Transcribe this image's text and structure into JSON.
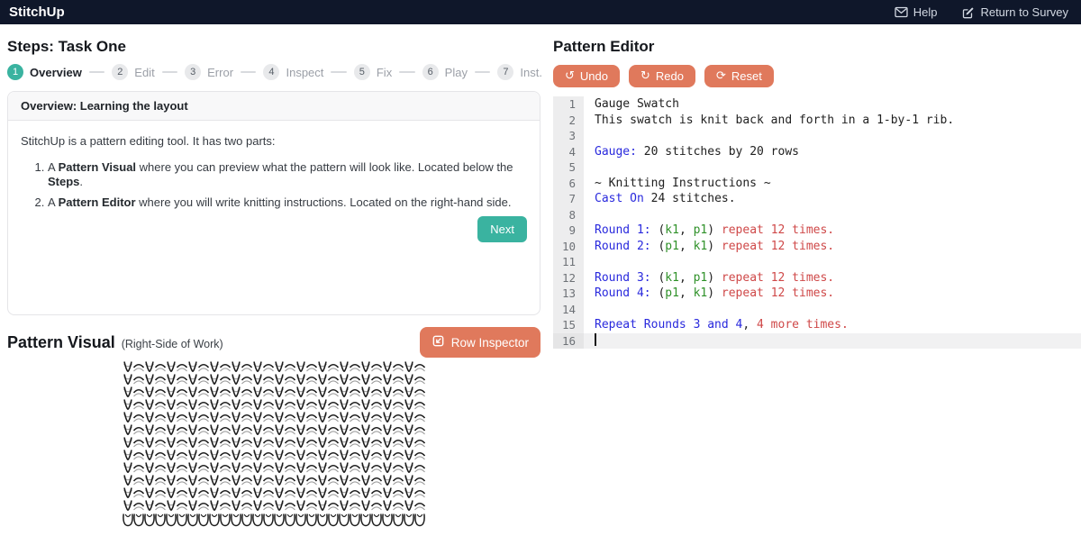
{
  "theme": {
    "navbar_bg": "#0f172a",
    "accent_teal": "#3ab3a0",
    "accent_salmon": "#e0795c",
    "code_blue": "#2929dd",
    "code_green": "#2f9129",
    "code_red": "#cf4848"
  },
  "navbar": {
    "brand": "StitchUp",
    "help_label": "Help",
    "return_label": "Return to Survey"
  },
  "steps": {
    "title": "Steps: Task One",
    "items": [
      {
        "num": "1",
        "label": "Overview",
        "active": true
      },
      {
        "num": "2",
        "label": "Edit",
        "active": false
      },
      {
        "num": "3",
        "label": "Error",
        "active": false
      },
      {
        "num": "4",
        "label": "Inspect",
        "active": false
      },
      {
        "num": "5",
        "label": "Fix",
        "active": false
      },
      {
        "num": "6",
        "label": "Play",
        "active": false
      },
      {
        "num": "7",
        "label": "Inst.",
        "active": false
      }
    ]
  },
  "overview_card": {
    "header": "Overview: Learning the layout",
    "intro": "StitchUp is a pattern editing tool. It has two parts:",
    "list": [
      [
        {
          "t": "A "
        },
        {
          "t": "Pattern Visual",
          "c": "bold"
        },
        {
          "t": " where you can preview what the pattern will look like. Located below the "
        },
        {
          "t": "Steps",
          "c": "bold"
        },
        {
          "t": "."
        }
      ],
      [
        {
          "t": "A "
        },
        {
          "t": "Pattern Editor",
          "c": "bold"
        },
        {
          "t": " where you will write knitting instructions. Located on the right-hand side."
        }
      ]
    ],
    "next_label": "Next"
  },
  "pattern_visual": {
    "title": "Pattern Visual",
    "subtitle": "(Right-Side of Work)",
    "inspector_label": "Row Inspector"
  },
  "editor": {
    "title": "Pattern Editor",
    "buttons": [
      {
        "icon": "undo-icon",
        "glyph": "↺",
        "label": "Undo"
      },
      {
        "icon": "redo-icon",
        "glyph": "↻",
        "label": "Redo"
      },
      {
        "icon": "reset-icon",
        "glyph": "⟳",
        "label": "Reset"
      }
    ],
    "active_line": 16,
    "lines": [
      [
        {
          "c": "k",
          "t": "Gauge Swatch"
        }
      ],
      [
        {
          "c": "k",
          "t": "This swatch is knit back and forth in a 1-by-1 rib."
        }
      ],
      [],
      [
        {
          "c": "b",
          "t": "Gauge:"
        },
        {
          "c": "k",
          "t": " 20 stitches by 20 rows"
        }
      ],
      [],
      [
        {
          "c": "k",
          "t": "~ Knitting Instructions ~"
        }
      ],
      [
        {
          "c": "b",
          "t": "Cast On"
        },
        {
          "c": "k",
          "t": " 24 stitches."
        }
      ],
      [],
      [
        {
          "c": "b",
          "t": "Round 1:"
        },
        {
          "c": "k",
          "t": " ("
        },
        {
          "c": "g",
          "t": "k1"
        },
        {
          "c": "k",
          "t": ", "
        },
        {
          "c": "g",
          "t": "p1"
        },
        {
          "c": "k",
          "t": ") "
        },
        {
          "c": "r",
          "t": "repeat 12 times."
        }
      ],
      [
        {
          "c": "b",
          "t": "Round 2:"
        },
        {
          "c": "k",
          "t": " ("
        },
        {
          "c": "g",
          "t": "p1"
        },
        {
          "c": "k",
          "t": ", "
        },
        {
          "c": "g",
          "t": "k1"
        },
        {
          "c": "k",
          "t": ") "
        },
        {
          "c": "r",
          "t": "repeat 12 times."
        }
      ],
      [],
      [
        {
          "c": "b",
          "t": "Round 3:"
        },
        {
          "c": "k",
          "t": " ("
        },
        {
          "c": "g",
          "t": "k1"
        },
        {
          "c": "k",
          "t": ", "
        },
        {
          "c": "g",
          "t": "p1"
        },
        {
          "c": "k",
          "t": ") "
        },
        {
          "c": "r",
          "t": "repeat 12 times."
        }
      ],
      [
        {
          "c": "b",
          "t": "Round 4:"
        },
        {
          "c": "k",
          "t": " ("
        },
        {
          "c": "g",
          "t": "p1"
        },
        {
          "c": "k",
          "t": ", "
        },
        {
          "c": "g",
          "t": "k1"
        },
        {
          "c": "k",
          "t": ") "
        },
        {
          "c": "r",
          "t": "repeat 12 times."
        }
      ],
      [],
      [
        {
          "c": "b",
          "t": "Repeat Rounds 3 and 4"
        },
        {
          "c": "k",
          "t": ", "
        },
        {
          "c": "r",
          "t": "4 more times."
        }
      ],
      []
    ]
  }
}
